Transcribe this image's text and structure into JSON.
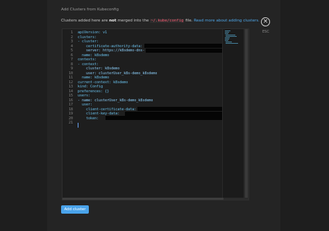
{
  "title": "Add Clusters from Kubeconfig",
  "notice": {
    "prefix": "Clusters added here are ",
    "emphasis": "not",
    "middle": " merged into the ",
    "path": "~/.kube/config",
    "suffix": " file. ",
    "link": "Read more about adding clusters."
  },
  "close": {
    "icon": "×",
    "label": "ESC"
  },
  "editor": {
    "lines": [
      {
        "n": "1",
        "text": "apiVersion: v1"
      },
      {
        "n": "2",
        "text": "clusters:"
      },
      {
        "n": "3",
        "text": "- cluster:"
      },
      {
        "n": "4",
        "text": "    certificate-authority-data:"
      },
      {
        "n": "5",
        "text": "    server: https://k8sdemo-dns-"
      },
      {
        "n": "6",
        "text": "  name: k8sdemo"
      },
      {
        "n": "7",
        "text": "contexts:"
      },
      {
        "n": "8",
        "text": "- context:"
      },
      {
        "n": "9",
        "text": "    cluster: k8sdemo"
      },
      {
        "n": "10",
        "text": "    user: clusterUser_k8s-demo_k8sdemo"
      },
      {
        "n": "11",
        "text": "  name: k8sdemo"
      },
      {
        "n": "12",
        "text": "current-context: k8sdemo"
      },
      {
        "n": "13",
        "text": "kind: Config"
      },
      {
        "n": "14",
        "text": "preferences: {}"
      },
      {
        "n": "15",
        "text": "users:"
      },
      {
        "n": "16",
        "text": "- name: clusterUser_k8s-demo_k8sdemo"
      },
      {
        "n": "17",
        "text": "  user:"
      },
      {
        "n": "18",
        "text": "    client-certificate-data:"
      },
      {
        "n": "19",
        "text": "    client-key-data:"
      },
      {
        "n": "20",
        "text": "    token:"
      },
      {
        "n": "21",
        "text": ""
      }
    ]
  },
  "button": {
    "label": "Add cluster"
  },
  "colors": {
    "accent": "#4aa3ea",
    "path_text": "#ff5b73",
    "link": "#4ea6e8"
  }
}
